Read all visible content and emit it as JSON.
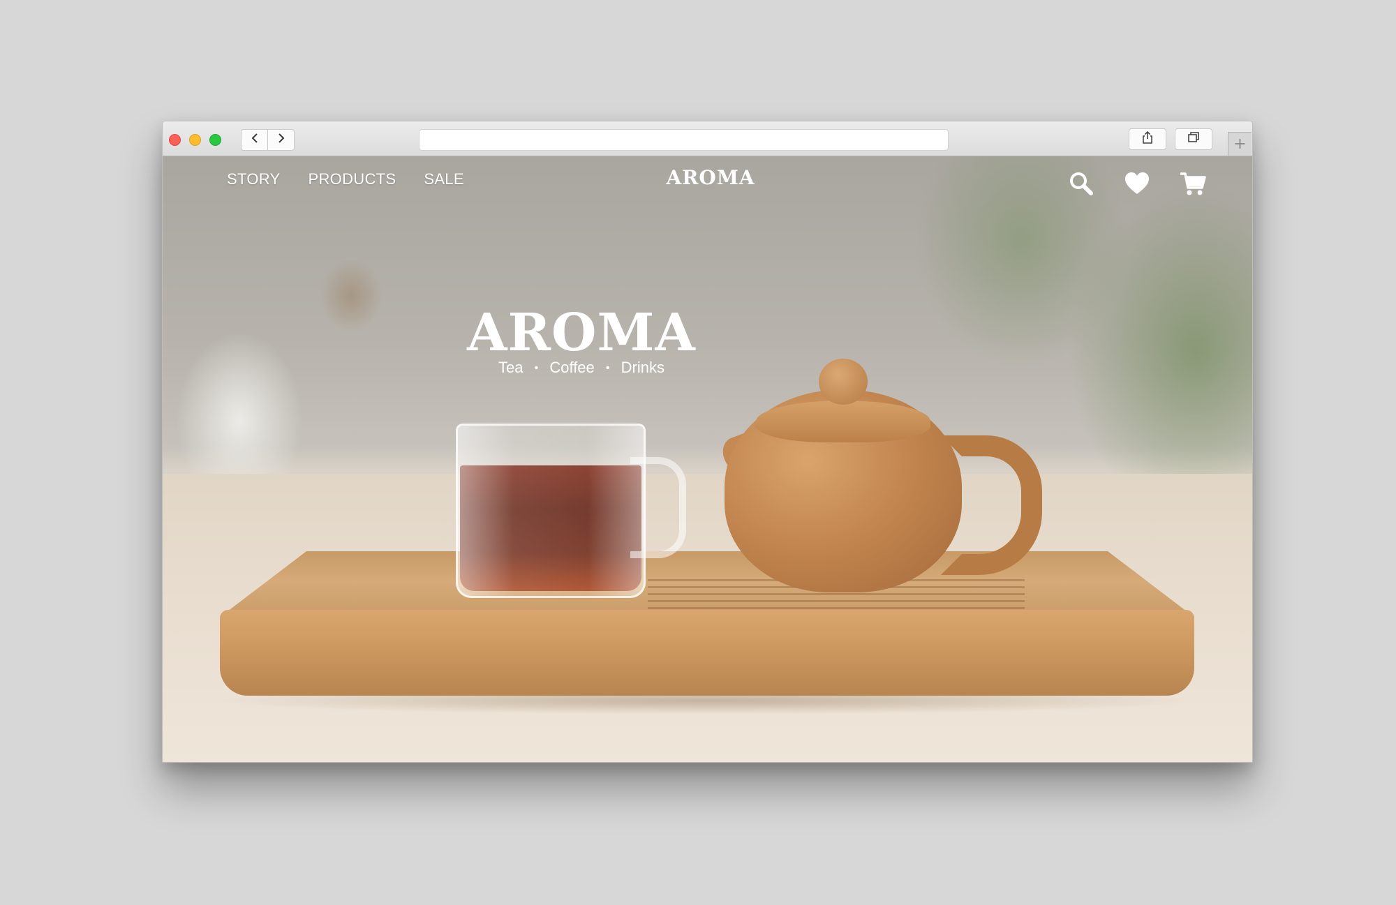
{
  "browser": {
    "url": "",
    "icons": {
      "back": "chevron-left-icon",
      "forward": "chevron-right-icon",
      "share": "share-icon",
      "tabs": "tabs-overview-icon",
      "new_tab": "plus-icon"
    },
    "new_tab_glyph": "+"
  },
  "site": {
    "nav": {
      "links": [
        "STORY",
        "PRODUCTS",
        "SALE"
      ],
      "logo": "AROMA",
      "icons": [
        "search-icon",
        "heart-icon",
        "cart-icon"
      ]
    },
    "hero": {
      "title": "AROMA",
      "tagline": [
        "Tea",
        "Coffee",
        "Drinks"
      ],
      "separator": "•"
    }
  },
  "colors": {
    "page_background": "#d7d7d7",
    "traffic_close": "#fc5f56",
    "traffic_minimize": "#fdbd2e",
    "traffic_maximize": "#28c840",
    "nav_text": "#ffffff"
  }
}
